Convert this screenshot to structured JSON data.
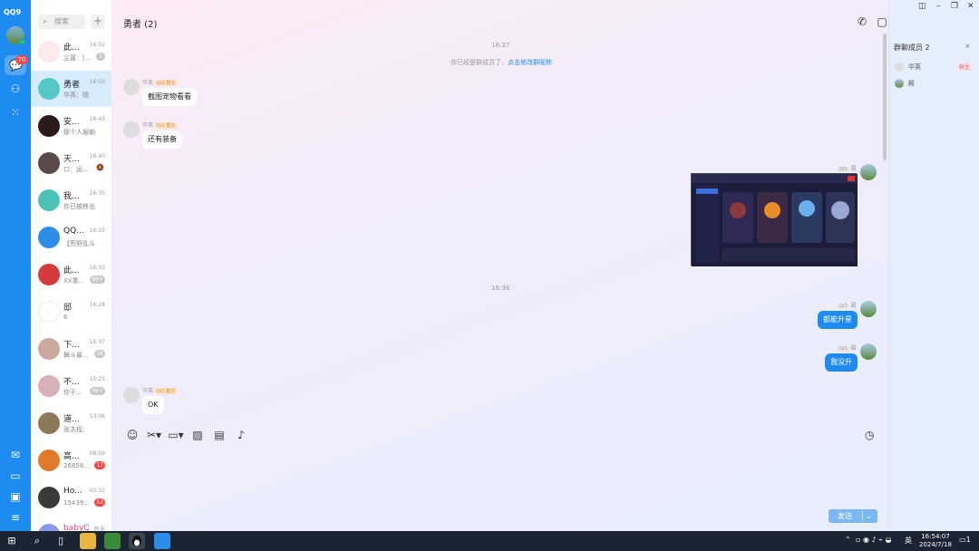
{
  "app": {
    "logo": "QQ9"
  },
  "rail": {
    "unread_badge": "70",
    "icons": [
      "chat-icon",
      "contacts-icon",
      "apps-grid-icon",
      "mail-icon",
      "folder-icon",
      "favorites-icon",
      "menu-icon"
    ]
  },
  "search": {
    "placeholder": "搜索"
  },
  "conversations": [
    {
      "name": "此...",
      "time": "16:52",
      "preview": "尘嚣：[...",
      "badge": "1",
      "badge_type": "grey",
      "avatar": "#fbe9ec"
    },
    {
      "name": "勇者",
      "time": "16:50",
      "preview": "华英：嗯",
      "badge": "",
      "badge_type": "",
      "avatar": "#56c8c9",
      "active": true
    },
    {
      "name": "安...",
      "time": "16:43",
      "preview": "那个人服躺子",
      "badge": "",
      "badge_type": "",
      "avatar": "#2a1a1a"
    },
    {
      "name": "天...",
      "time": "16:40",
      "preview": "口：运...",
      "badge": "",
      "badge_type": "mute",
      "avatar": "#5a4a4a"
    },
    {
      "name": "我...",
      "time": "16:35",
      "preview": "你已被移出...",
      "badge": "",
      "badge_type": "",
      "avatar": "#4bc3b6"
    },
    {
      "name": "QQ...",
      "time": "16:33",
      "preview": "【荒野乱斗...",
      "badge": "",
      "badge_type": "",
      "avatar": "#2e8de8"
    },
    {
      "name": "此...",
      "time": "16:33",
      "preview": "XX重...",
      "badge": "99+",
      "badge_type": "grey",
      "avatar": "#d63b3b"
    },
    {
      "name": "邸",
      "time": "16:28",
      "preview": "6",
      "badge": "",
      "badge_type": "",
      "avatar": "#fff"
    },
    {
      "name": "下...",
      "time": "15:37",
      "preview": "舞斗最...",
      "badge": "28",
      "badge_type": "grey",
      "avatar": "#c9a9a0"
    },
    {
      "name": "不...",
      "time": "15:25",
      "preview": "你干...",
      "badge": "99+",
      "badge_type": "grey",
      "avatar": "#d9b0b8"
    },
    {
      "name": "道...",
      "time": "13:06",
      "preview": "张志程:",
      "badge": "",
      "badge_type": "",
      "avatar": "#8b7a5a"
    },
    {
      "name": "高...",
      "time": "08:59",
      "preview": "26858...",
      "badge": "17",
      "badge_type": "red",
      "avatar": "#e07a2a"
    },
    {
      "name": "Ho...",
      "time": "03:32",
      "preview": "15439...",
      "badge": "53",
      "badge_type": "red",
      "avatar": "#3a3a3a"
    },
    {
      "name": "babyQ",
      "time": "昨天",
      "preview": "",
      "badge": "",
      "badge_type": "",
      "avatar": "#8a9ae8"
    }
  ],
  "chat": {
    "title": "勇者 (2)",
    "timestamps": [
      "16:37",
      "16:38"
    ],
    "system_message": "你已经是群成员了，",
    "system_link": "点击修改群昵称",
    "messages": [
      {
        "sender": "华英",
        "level": "LV2 群主",
        "text": "截图宠物看看",
        "side": "in"
      },
      {
        "sender": "华英",
        "level": "LV2 群主",
        "text": "还有装备",
        "side": "in"
      },
      {
        "sender": "殿",
        "level": "LV1",
        "text": "[图片]",
        "side": "out"
      },
      {
        "sender": "殿",
        "level": "LV1",
        "text": "都能升星",
        "side": "out"
      },
      {
        "sender": "殿",
        "level": "LV1",
        "text": "我没升",
        "side": "out"
      },
      {
        "sender": "华英",
        "level": "LV2 群主",
        "text": "OK",
        "side": "in"
      }
    ]
  },
  "composer": {
    "send_label": "发送"
  },
  "members": {
    "title": "群聊成员 2",
    "list": [
      {
        "name": "华英",
        "role": "群主"
      },
      {
        "name": "殿",
        "role": ""
      }
    ]
  },
  "taskbar": {
    "ime": "英",
    "time": "16:54:07",
    "date": "2024/7/18",
    "notif": "1"
  },
  "colors": {
    "accent": "#1e8bf0",
    "rail": "#1e8bf0",
    "badge": "#ff4444"
  }
}
